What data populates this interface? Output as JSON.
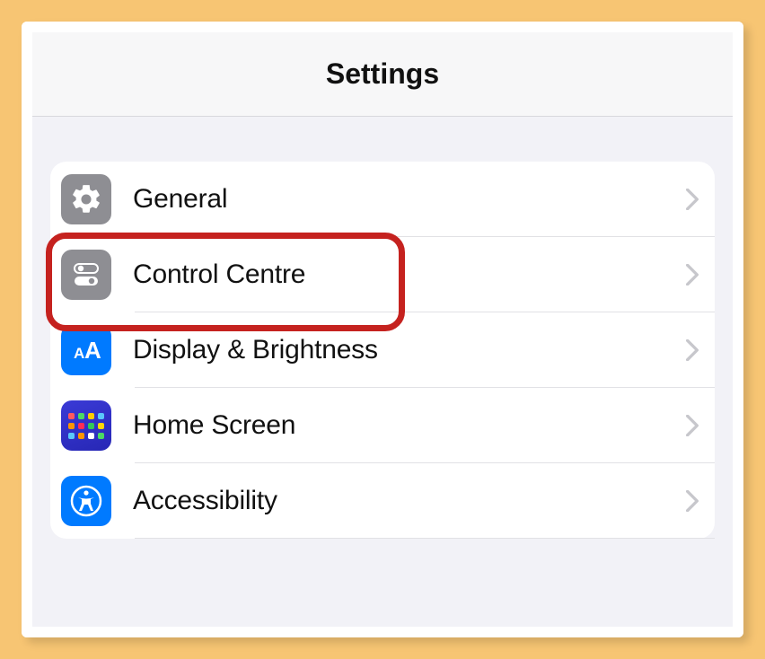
{
  "header": {
    "title": "Settings"
  },
  "items": [
    {
      "label": "General",
      "icon": "gear-icon",
      "highlighted": false
    },
    {
      "label": "Control Centre",
      "icon": "toggle-icon",
      "highlighted": true
    },
    {
      "label": "Display & Brightness",
      "icon": "text-size-icon",
      "highlighted": false
    },
    {
      "label": "Home Screen",
      "icon": "home-grid-icon",
      "highlighted": false
    },
    {
      "label": "Accessibility",
      "icon": "accessibility-icon",
      "highlighted": false
    }
  ],
  "colors": {
    "highlight": "#c5221f",
    "gray": "#8e8e93",
    "blue": "#007aff"
  }
}
